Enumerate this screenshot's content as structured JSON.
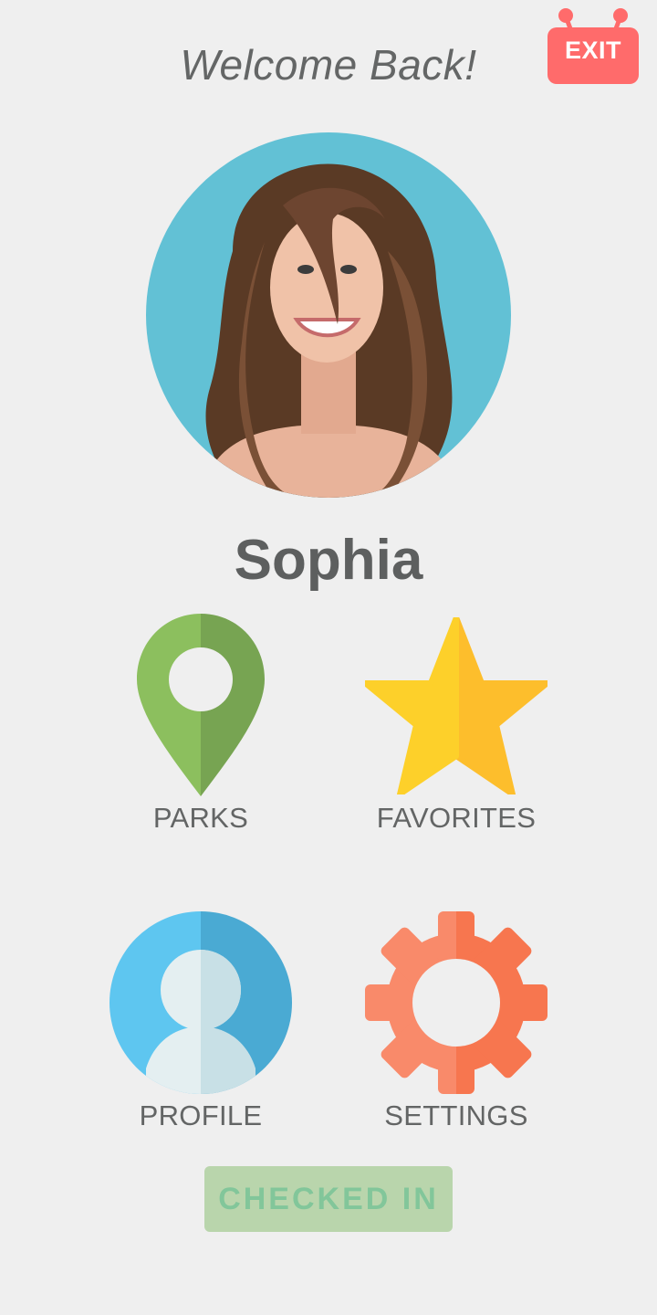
{
  "header": {
    "welcome_text": "Welcome Back!",
    "exit_label": "EXIT"
  },
  "profile": {
    "name": "Sophia",
    "avatar_icon": "user-photo"
  },
  "menu": {
    "items": [
      {
        "label": "PARKS",
        "icon": "map-pin-icon",
        "color": "#8cbf5e"
      },
      {
        "label": "FAVORITES",
        "icon": "star-icon",
        "color": "#fdd02a"
      },
      {
        "label": "PROFILE",
        "icon": "person-icon",
        "color": "#5ec6f0"
      },
      {
        "label": "SETTINGS",
        "icon": "gear-icon",
        "color": "#f98a6a"
      }
    ]
  },
  "status": {
    "checked_in_label": "CHECKED IN"
  },
  "colors": {
    "background": "#efefef",
    "exit": "#ff6b6b",
    "checked_in_bg": "#b9d5ac",
    "checked_in_text": "#82c69a"
  }
}
